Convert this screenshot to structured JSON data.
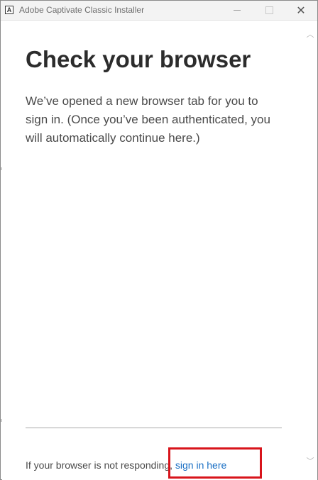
{
  "window": {
    "title": "Adobe Captivate Classic Installer",
    "app_icon_glyph": "A",
    "minimize_icon": "minimize-icon",
    "maximize_icon": "maximize-icon",
    "close_glyph": "✕"
  },
  "main": {
    "heading": "Check your browser",
    "message": "We’ve opened a new browser tab for you to sign in. (Once you’ve been authenticated, you will automatically continue here.)"
  },
  "footer": {
    "prefix": "If your browser is not responding, ",
    "link_label": "sign in here"
  },
  "scrollbar": {
    "up_glyph": "︿",
    "down_glyph": "﹀"
  },
  "colors": {
    "link": "#1a6fc4",
    "highlight": "#d8141b",
    "heading": "#2c2c2c"
  }
}
